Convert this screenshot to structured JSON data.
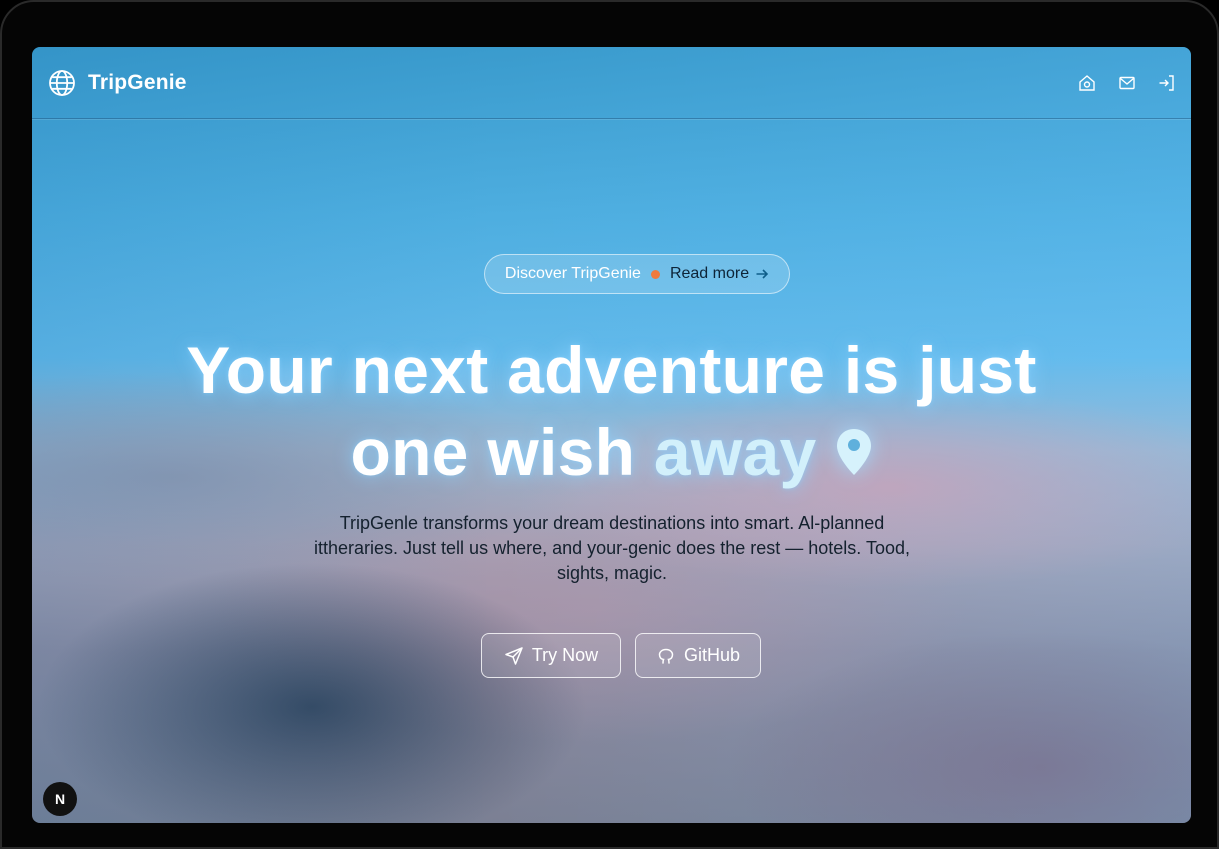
{
  "brand": {
    "name": "TripGenie",
    "icon": "globe-icon"
  },
  "nav": {
    "icons": [
      "home-icon",
      "mail-icon",
      "sign-in-icon"
    ]
  },
  "announcement": {
    "label": "Discover TripGenie",
    "link": "Read more",
    "dot_color": "#f07a3c"
  },
  "hero": {
    "title_line1": "Your next adventure is just",
    "title_line2_part1": "one wish",
    "title_line2_accent": "away",
    "pin_icon": "map-pin-icon",
    "subtitle": "TripGenle transforms your dream destinations into smart. Al-planned ittheraries. Just tell us where, and your-genic does the rest — hotels. Tood, sights, magic."
  },
  "cta": {
    "primary_label": "Try Now",
    "primary_icon": "send-icon",
    "secondary_label": "GitHub",
    "secondary_icon": "github-icon"
  },
  "badge": {
    "label": "N"
  },
  "colors": {
    "accent_text": "#d2f0fb",
    "subtitle_text": "#14212e",
    "sky_top": "#3a9bcd",
    "sky_light": "#62b9ea"
  }
}
